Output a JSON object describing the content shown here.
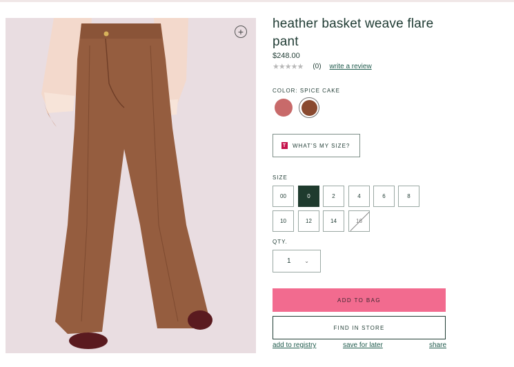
{
  "product": {
    "title": "heather basket weave flare pant",
    "price": "$248.00",
    "rating_stars": "★★★★★",
    "review_count": "(0)",
    "write_review": "write a review",
    "zoom_icon": "plus-circle-icon"
  },
  "color": {
    "label": "COLOR: SPICE CAKE",
    "swatches": [
      {
        "name": "pink",
        "hex": "#c86a6a"
      },
      {
        "name": "spice cake",
        "hex": "#8a4a30",
        "selected": true
      }
    ]
  },
  "size_help": {
    "icon_text": "T",
    "label": "WHAT'S MY SIZE?"
  },
  "size": {
    "label": "SIZE",
    "options": [
      "00",
      "0",
      "2",
      "4",
      "6",
      "8",
      "10",
      "12",
      "14",
      "16"
    ],
    "selected": "0",
    "unavailable": [
      "16"
    ]
  },
  "qty": {
    "label": "QTY.",
    "value": "1",
    "chevron": "⌄"
  },
  "actions": {
    "add_to_bag": "ADD TO BAG",
    "find_in_store": "FIND IN STORE",
    "add_to_registry": "add to registry",
    "save_for_later": "save for later",
    "share": "share"
  },
  "colors": {
    "brand_green": "#1f3b33",
    "add_to_bag_bg": "#f26b8f",
    "image_bg": "#e9dde1"
  }
}
